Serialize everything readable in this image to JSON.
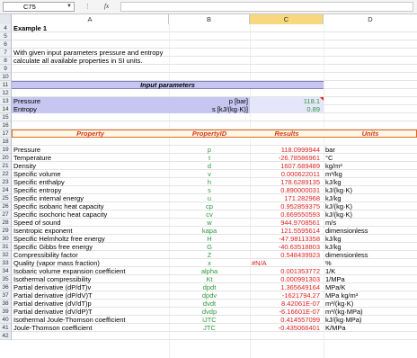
{
  "formula_bar": {
    "name_box": "C75",
    "fx": "fx",
    "formula": ""
  },
  "columns": [
    "A",
    "B",
    "C",
    "D"
  ],
  "example_title": "Example 1",
  "intro": [
    "With given input parameters pressure and entropy",
    "calculate all available properties in SI units."
  ],
  "input_header": "Input parameters",
  "inputs": [
    {
      "name": "Pressure",
      "unit": "p [bar]",
      "value": "118.1"
    },
    {
      "name": "Entropy",
      "unit": "s [kJ/(kg·K)]",
      "value": "0.89"
    }
  ],
  "table_header": {
    "property": "Property",
    "id": "PropertyID",
    "results": "Results",
    "units": "Units"
  },
  "rows": [
    {
      "n": "19",
      "name": "Pressure",
      "id": "p",
      "val": "118.0999944",
      "unit": "bar"
    },
    {
      "n": "20",
      "name": "Temperature",
      "id": "t",
      "val": "-26.78586961",
      "unit": "°C"
    },
    {
      "n": "21",
      "name": "Density",
      "id": "d",
      "val": "1607.689489",
      "unit": "kg/m³"
    },
    {
      "n": "22",
      "name": "Specific volume",
      "id": "v",
      "val": "0.000622011",
      "unit": "m³/kg"
    },
    {
      "n": "23",
      "name": "Specific enthalpy",
      "id": "h",
      "val": "178.6289135",
      "unit": "kJ/kg"
    },
    {
      "n": "24",
      "name": "Specific entropy",
      "id": "s",
      "val": "0.890000031",
      "unit": "kJ/(kg·K)"
    },
    {
      "n": "25",
      "name": "Specific internal energy",
      "id": "u",
      "val": "171.282968",
      "unit": "kJ/kg"
    },
    {
      "n": "26",
      "name": "Specific isobaric heat capacity",
      "id": "cp",
      "val": "0.952859375",
      "unit": "kJ/(kg·K)"
    },
    {
      "n": "27",
      "name": "Specific isochoric heat capacity",
      "id": "cv",
      "val": "0.669550593",
      "unit": "kJ/(kg·K)"
    },
    {
      "n": "28",
      "name": "Speed of sound",
      "id": "w",
      "val": "944.9708561",
      "unit": "m/s"
    },
    {
      "n": "29",
      "name": "Isentropic exponent",
      "id": "kapa",
      "val": "121.5595614",
      "unit": "dimensionless"
    },
    {
      "n": "30",
      "name": "Specific Helmholtz free energy",
      "id": "H",
      "val": "-47.98113358",
      "unit": "kJ/kg"
    },
    {
      "n": "31",
      "name": "Specific Gibbs free energy",
      "id": "G",
      "val": "-40.63518803",
      "unit": "kJ/kg"
    },
    {
      "n": "32",
      "name": "Compressibility factor",
      "id": "Z",
      "val": "0.548439923",
      "unit": "dimensionless"
    },
    {
      "n": "33",
      "name": "Quality (vapor mass fraction)",
      "id": "x",
      "val": "#N/A",
      "unit": "%"
    },
    {
      "n": "34",
      "name": "Isobaric volume expansion coefficient",
      "id": "alpha",
      "val": "0.001353772",
      "unit": "1/K"
    },
    {
      "n": "35",
      "name": "Isothermal compressibility",
      "id": "Kt",
      "val": "0.000991303",
      "unit": "1/MPa"
    },
    {
      "n": "36",
      "name": "Partial derivative (dP/dT)v",
      "id": "dpdt",
      "val": "1.365649164",
      "unit": "MPa/K"
    },
    {
      "n": "37",
      "name": "Partial derivative (dP/dV)T",
      "id": "dpdv",
      "val": "-1621794.27",
      "unit": "MPa kg/m³"
    },
    {
      "n": "38",
      "name": "Partial derivative (dV/dT)p",
      "id": "dvdt",
      "val": "8.42061E-07",
      "unit": "m³/(kg·K)"
    },
    {
      "n": "39",
      "name": "Partial derivative (dV/dP)T",
      "id": "dvdp",
      "val": "-6.16601E-07",
      "unit": "m³/(kg·MPa)"
    },
    {
      "n": "40",
      "name": "Isothermal Joule-Thomson coefficient",
      "id": "iJTC",
      "val": "0.414557099",
      "unit": "kJ/(kg·MPa)"
    },
    {
      "n": "41",
      "name": "Joule-Thomson coefficient",
      "id": "JTC",
      "val": "-0.435066401",
      "unit": "K/MPa"
    }
  ],
  "row_numbers": [
    "4",
    "5",
    "6",
    "7",
    "8",
    "9",
    "10",
    "11",
    "12",
    "13",
    "14",
    "15",
    "16",
    "17",
    "18",
    "19",
    "20",
    "21",
    "22",
    "23",
    "24",
    "25",
    "26",
    "27",
    "28",
    "29",
    "30",
    "31",
    "32",
    "33",
    "34",
    "35",
    "36",
    "37",
    "38",
    "39",
    "40",
    "41",
    "42"
  ]
}
